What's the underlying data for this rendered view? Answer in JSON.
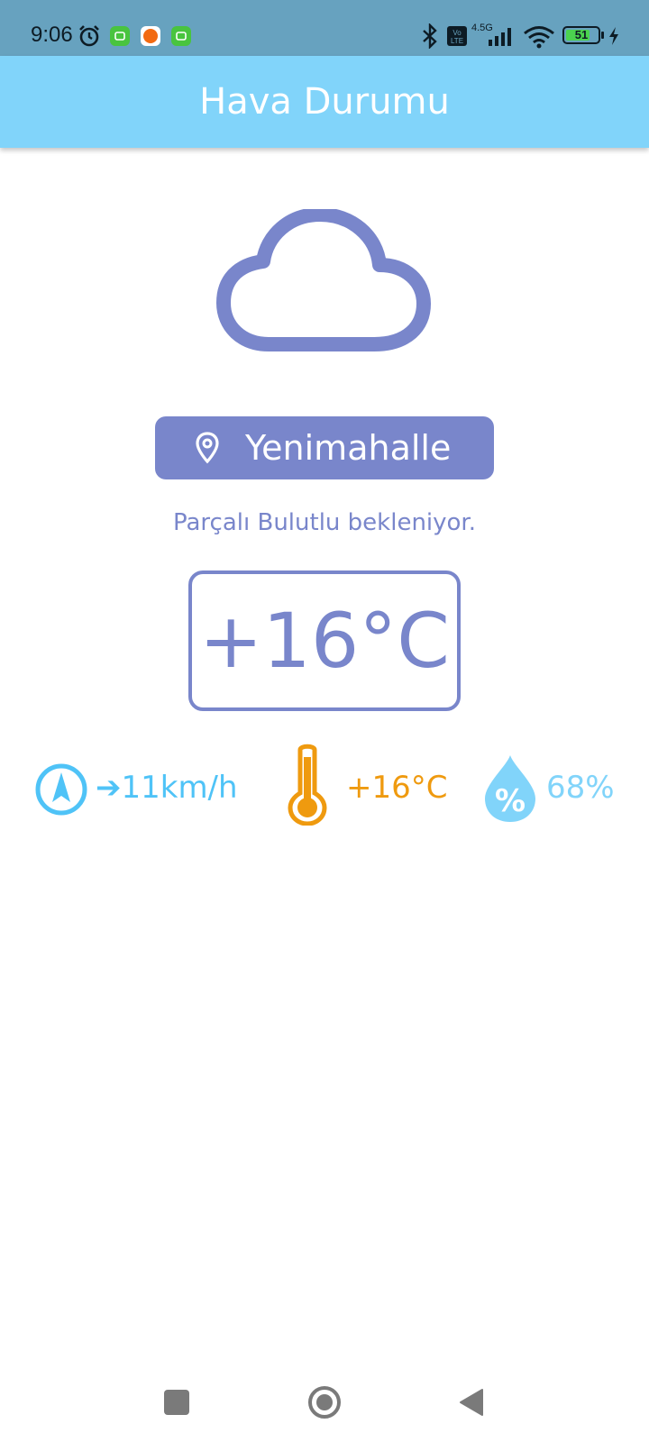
{
  "status_bar": {
    "time": "9:06",
    "network": "4.5G",
    "battery": "51",
    "icons": [
      "alarm-icon",
      "app-notification-icon",
      "app-notification-icon",
      "app-notification-icon",
      "bluetooth-icon",
      "volte-icon",
      "signal-icon",
      "wifi-icon",
      "battery-icon",
      "charging-icon"
    ]
  },
  "app_bar": {
    "title": "Hava Durumu"
  },
  "weather": {
    "condition_icon": "cloud-icon",
    "location": "Yenimahalle",
    "description": "Parçalı Bulutlu bekleniyor.",
    "temperature": "+16°C",
    "wind": "➔11km/h",
    "feels_like": "+16°C",
    "humidity": "68%"
  },
  "colors": {
    "status_bar": "#67a2bf",
    "app_bar": "#81d4fa",
    "primary": "#7986cb",
    "wind": "#4fc3f7",
    "temperature": "#ef9a0f",
    "humidity": "#81d4fa"
  },
  "nav_bar": {
    "icons": [
      "recents-icon",
      "home-icon",
      "back-icon"
    ]
  }
}
